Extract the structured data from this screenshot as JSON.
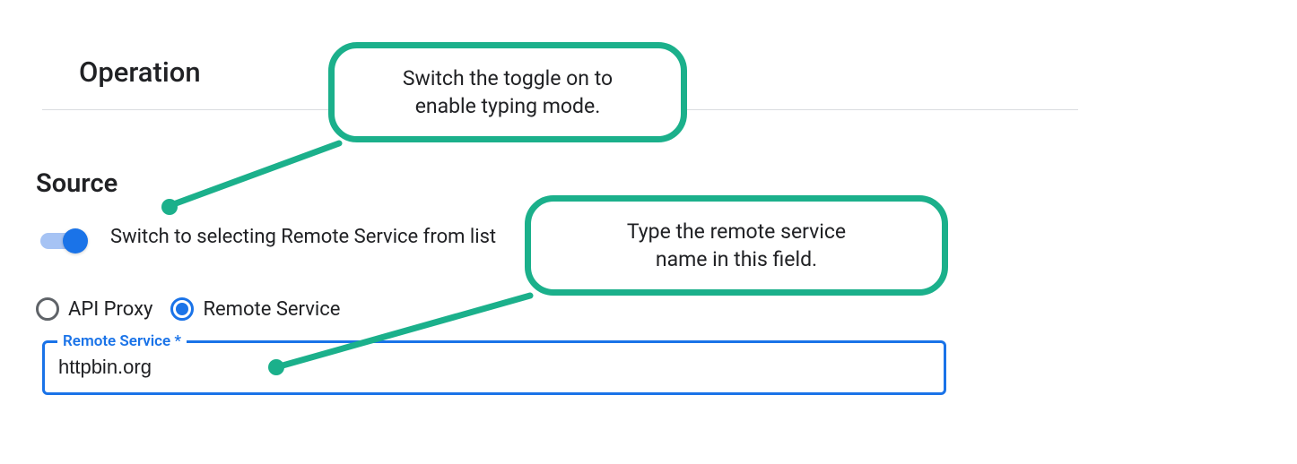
{
  "headers": {
    "operation": "Operation",
    "source": "Source"
  },
  "toggle": {
    "label": "Switch to selecting Remote Service from list"
  },
  "radios": {
    "api_proxy": "API Proxy",
    "remote_service": "Remote Service"
  },
  "input": {
    "legend": "Remote Service *",
    "value": "httpbin.org"
  },
  "callouts": {
    "toggle_hint_line1": "Switch the toggle on to",
    "toggle_hint_line2": "enable typing mode.",
    "field_hint_line1": "Type the remote service",
    "field_hint_line2": "name in this field."
  }
}
